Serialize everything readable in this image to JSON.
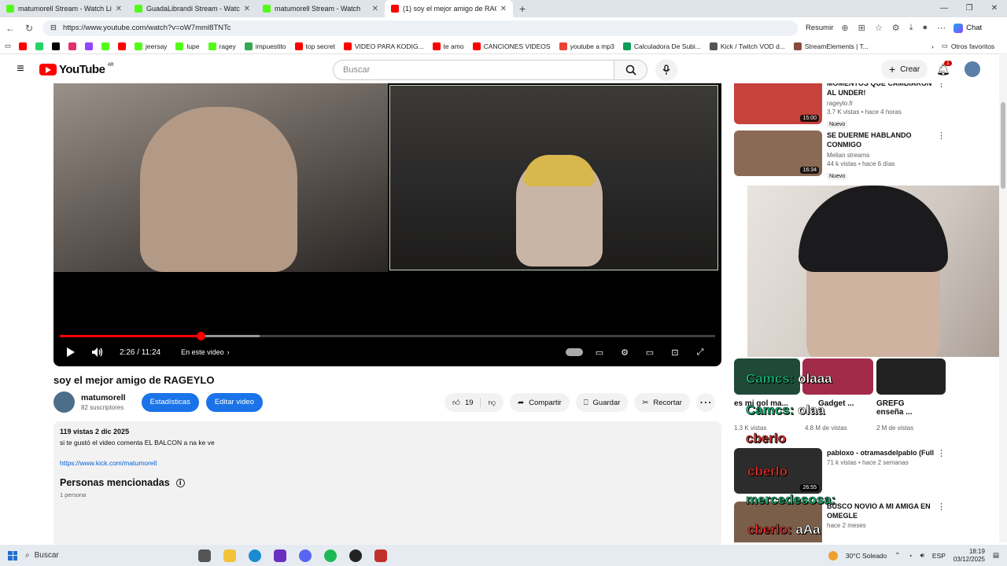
{
  "browser": {
    "tabs": [
      {
        "title": "matumorell Stream - Watch Live o",
        "icon_color": "#53fc18",
        "active": false
      },
      {
        "title": "GuadaLibrandi Stream - Watch",
        "icon_color": "#53fc18",
        "active": false
      },
      {
        "title": "matumorell Stream - Watch",
        "icon_color": "#53fc18",
        "active": false
      },
      {
        "title": "(1) soy el mejor amigo de RAGEYL",
        "icon_color": "#ff0000",
        "active": true
      }
    ],
    "url": "https://www.youtube.com/watch?v=oW7mml8TNTc",
    "resume_label": "Resumir",
    "chat_label": "Chat",
    "bookmarks": [
      {
        "label": "",
        "color": "#ff0000"
      },
      {
        "label": "",
        "color": "#25d366"
      },
      {
        "label": "",
        "color": "#000000"
      },
      {
        "label": "",
        "color": "#e1306c"
      },
      {
        "label": "",
        "color": "#9146ff"
      },
      {
        "label": "",
        "color": "#53fc18"
      },
      {
        "label": "",
        "color": "#ff0000"
      },
      {
        "label": "jeersay",
        "color": "#53fc18"
      },
      {
        "label": "lupe",
        "color": "#53fc18"
      },
      {
        "label": "ragey",
        "color": "#53fc18"
      },
      {
        "label": "impuestito",
        "color": "#34a853"
      },
      {
        "label": "top secret",
        "color": "#ff0000"
      },
      {
        "label": "VIDEO PARA KODIG...",
        "color": "#ff0000"
      },
      {
        "label": "te amo",
        "color": "#ff0000"
      },
      {
        "label": "CANCIONES VIDEOS",
        "color": "#ff0000"
      },
      {
        "label": "youtube a mp3",
        "color": "#ea4335"
      },
      {
        "label": "Calculadora De Subi...",
        "color": "#0f9d58"
      },
      {
        "label": "Kick / Twitch VOD d...",
        "color": "#555555"
      },
      {
        "label": "StreamElements | T...",
        "color": "#8a4b3a"
      }
    ],
    "other_favorites": "Otros favoritos"
  },
  "youtube": {
    "logo_text": "YouTube",
    "country": "AR",
    "search_placeholder": "Buscar",
    "create_label": "Crear",
    "notifications": "1"
  },
  "player": {
    "time": "2:26 / 11:24",
    "chapter": "En este video",
    "progress": 0.215,
    "buffered": 0.305
  },
  "video": {
    "title": "soy el mejor amigo de RAGEYLO",
    "channel": "matumorell",
    "subscribers": "82 suscriptores",
    "stats_button": "Estadísticas",
    "edit_button": "Editar video",
    "likes": "19",
    "share": "Compartir",
    "save": "Guardar",
    "clip": "Recortar"
  },
  "description": {
    "meta": "119 vistas  2 dic 2025",
    "text": "si te gustó el video comenta EL BALCON a na ke ve",
    "link": "https://www.kick.com/matumorell",
    "people_heading": "Personas mencionadas",
    "people_count": "1 persona"
  },
  "recommendations": [
    {
      "title": "MOMENTOS QUE CAMBIARON AL UNDER!",
      "channel": "rageylo.fr",
      "meta": "3.7 K vistas • hace 4 horas",
      "badge": "Nuevo",
      "duration": "15:00",
      "thumb": "#c6423a"
    },
    {
      "title": "SE DUERME HABLANDO CONMIGO",
      "channel": "Melian streams",
      "meta": "44 k vistas • hace 6 días",
      "badge": "Nuevo",
      "duration": "16:34",
      "thumb": "#8a6a55"
    },
    {
      "title": "pabloxo - otramasdelpablo (Full",
      "channel": "",
      "meta": "71 k vistas • hace 2 semanas",
      "badge": "",
      "duration": "26:55",
      "thumb": "#2c2c2c"
    },
    {
      "title": "BUSCO NOVIO A MI AMIGA EN OMEGLE",
      "channel": "",
      "meta": "hace 2 meses",
      "badge": "",
      "duration": "",
      "thumb": "#7a5e4a"
    }
  ],
  "shorts": [
    {
      "title": "es mi gol ma...",
      "meta": "1.3 K vistas"
    },
    {
      "title": "Gadget ...",
      "meta": "4.8 M de vistas"
    },
    {
      "title": "GREFG enseña ...",
      "meta": "2 M de vistas"
    }
  ],
  "chat_overlay": [
    {
      "user": "Camcs:",
      "msg": "olaaa",
      "color": "#19c37d"
    },
    {
      "user": "Camcs:",
      "msg": "olaa",
      "color": "#19c37d"
    },
    {
      "user": "cberlo",
      "msg": "",
      "color": "#e8302a"
    },
    {
      "user": "cberlo",
      "msg": "",
      "color": "#e8302a"
    },
    {
      "user": "mercedesosa:",
      "msg": "",
      "color": "#19c37d"
    },
    {
      "user": "cberlo:",
      "msg": "aAa",
      "color": "#e8302a"
    }
  ],
  "taskbar": {
    "search": "Buscar",
    "weather": "30°C  Soleado",
    "lang": "ESP",
    "time": "18:19",
    "date": "03/12/2025"
  }
}
